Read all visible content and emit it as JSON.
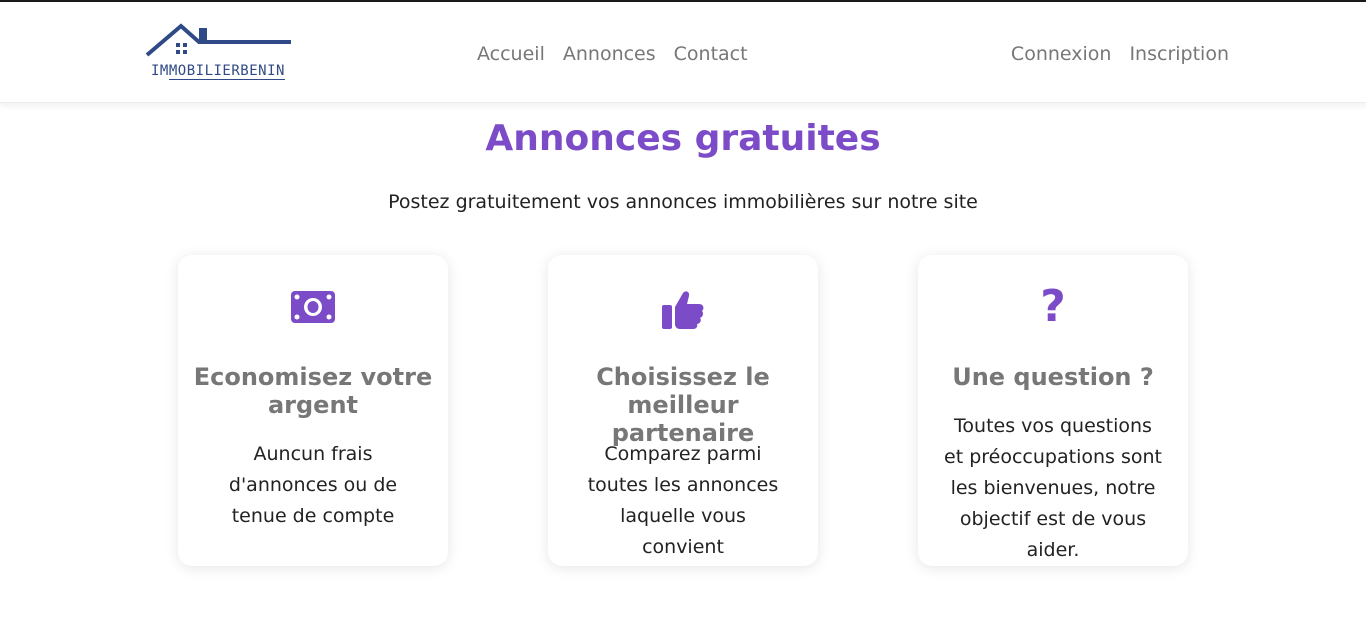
{
  "header": {
    "logo": {
      "text_prefix": "IM",
      "text_rest": "MOBILIERBENIN"
    },
    "nav_left": [
      "Accueil",
      "Annonces",
      "Contact"
    ],
    "nav_right": [
      "Connexion",
      "Inscription"
    ]
  },
  "hero": {
    "title": "Annonces gratuites",
    "subtitle": "Postez gratuitement vos annonces immobilières sur notre site"
  },
  "cards": [
    {
      "icon": "money-bill-icon",
      "title": "Economisez votre argent",
      "text": "Auncun frais d'annonces ou de tenue de compte"
    },
    {
      "icon": "thumbs-up-icon",
      "title": "Choisissez le meilleur partenaire",
      "text": "Comparez parmi toutes les annonces laquelle vous convient"
    },
    {
      "icon": "question-icon",
      "icon_glyph": "?",
      "title": "Une question ?",
      "text": "Toutes vos questions et préoccupations sont les bienvenues, notre objectif est de vous aider."
    }
  ],
  "colors": {
    "accent": "#7b4bc8",
    "logo": "#2f4a86",
    "nav_text": "#777777",
    "body_text": "#222222"
  }
}
